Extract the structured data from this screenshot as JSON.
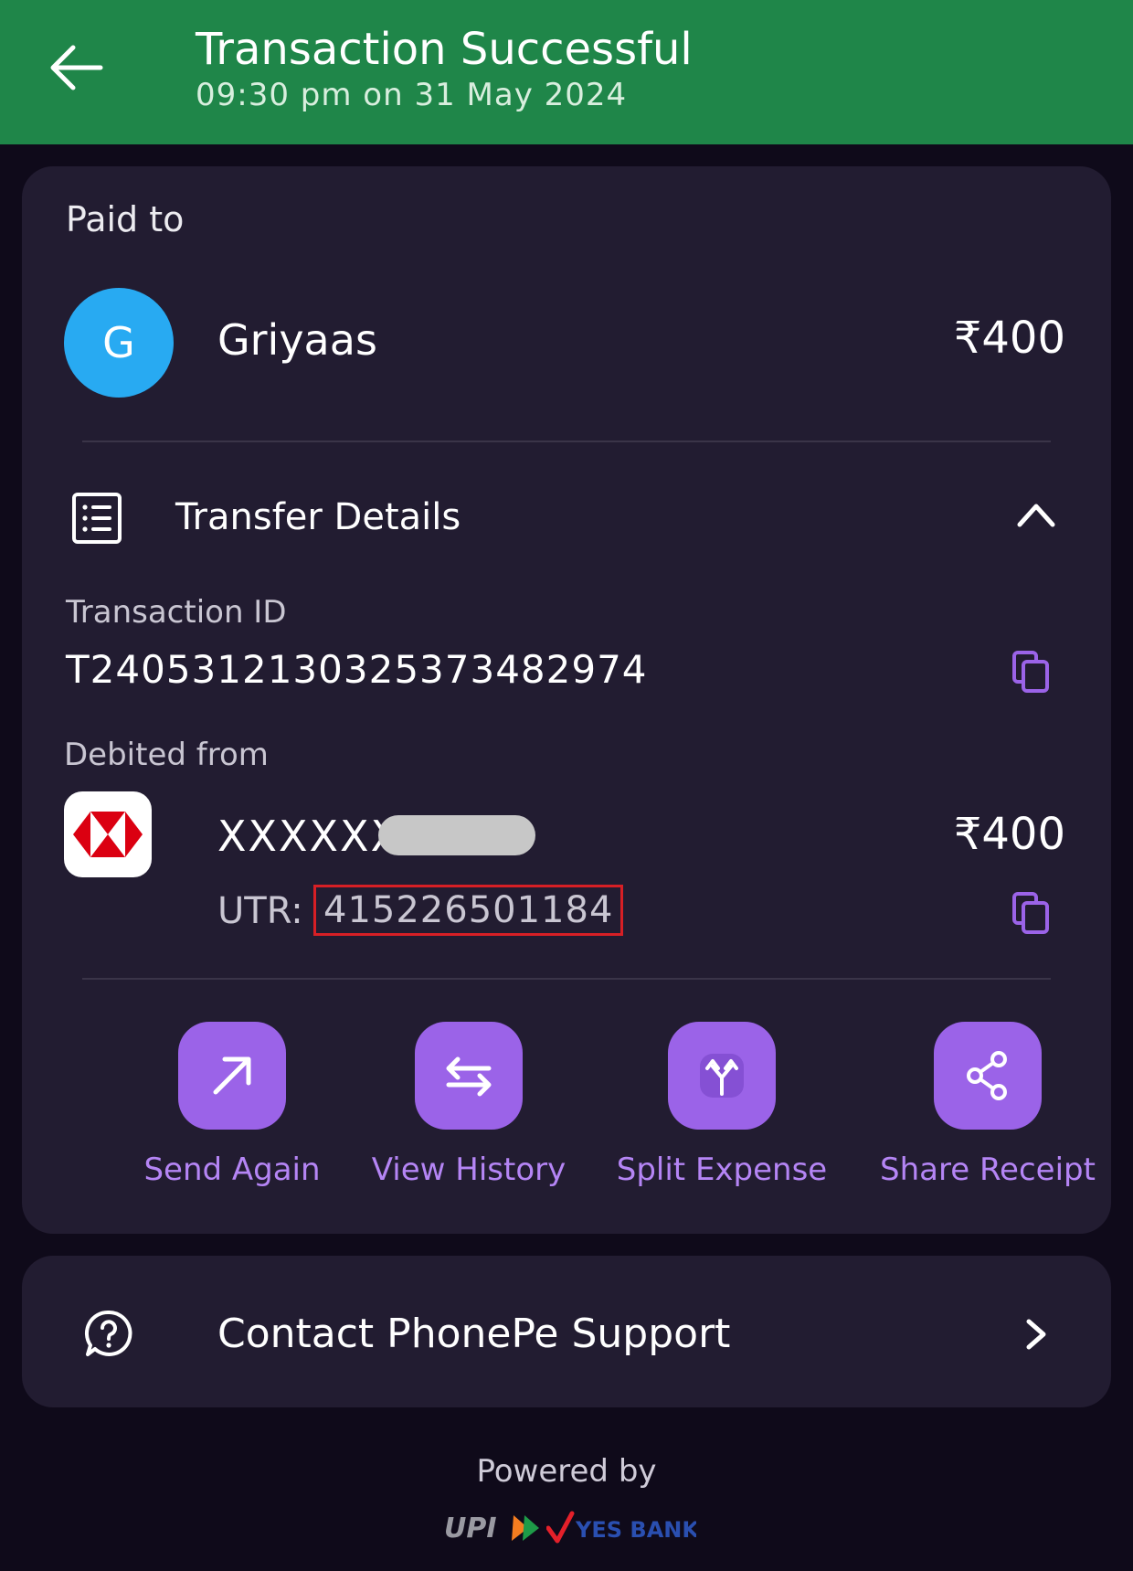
{
  "header": {
    "title": "Transaction Successful",
    "subtitle": "09:30 pm on 31 May 2024",
    "back_icon": "arrow-left-icon",
    "background_color": "#1f8649"
  },
  "payment": {
    "paid_to_label": "Paid to",
    "avatar_letter": "G",
    "payee_name": "Griyaas",
    "amount": "₹400"
  },
  "transfer_details": {
    "label": "Transfer Details",
    "icon": "receipt-list-icon",
    "expanded": true,
    "transaction_id_label": "Transaction ID",
    "transaction_id": "T2405312130325373482974",
    "debited_from_label": "Debited from",
    "account_number": "XXXXXX",
    "debit_amount": "₹400",
    "utr_label": "UTR:",
    "utr_value": "415226501184"
  },
  "actions": [
    {
      "label": "Send Again",
      "icon": "arrow-up-right-icon"
    },
    {
      "label": "View History",
      "icon": "swap-arrows-icon"
    },
    {
      "label": "Split Expense",
      "icon": "split-icon"
    },
    {
      "label": "Share Receipt",
      "icon": "share-icon"
    }
  ],
  "support": {
    "label": "Contact PhonePe Support",
    "icon": "help-chat-icon"
  },
  "footer": {
    "powered_by": "Powered by",
    "logo_text_upi": "UPI",
    "logo_text_bank": "YES BANK"
  },
  "colors": {
    "accent": "#9b63e8",
    "accent_text": "#b585f5",
    "card": "#221c31",
    "background": "#0f0a1a"
  }
}
